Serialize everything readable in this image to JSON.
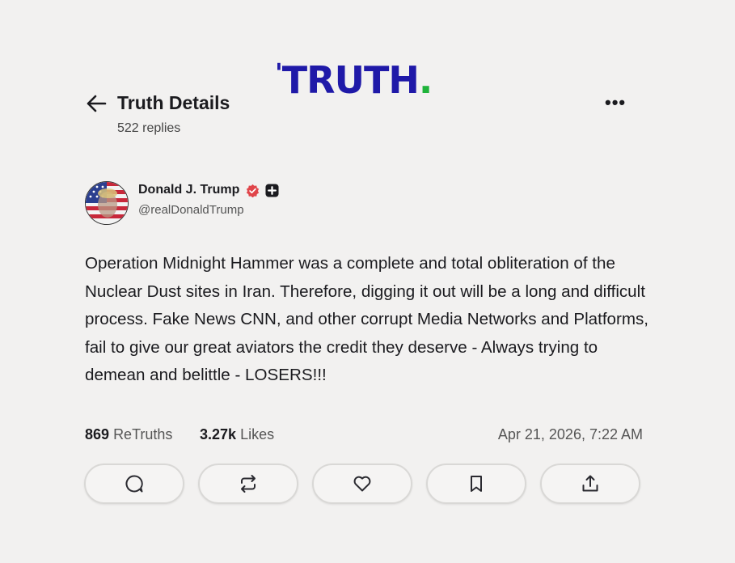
{
  "brand": {
    "logo_text": "TRUTH",
    "logo_dot": ".",
    "colors": {
      "logo": "#1f19a8",
      "dot": "#1fb33a",
      "verified": "#e0454a"
    }
  },
  "header": {
    "title": "Truth Details",
    "replies": "522 replies",
    "back_icon": "arrow-left-icon",
    "more_icon": "more-horizontal-icon"
  },
  "author": {
    "name": "Donald J. Trump",
    "handle": "@realDonaldTrump",
    "verified_icon": "verified-badge-icon",
    "badge_icon": "plus-badge-icon"
  },
  "post": {
    "text": "Operation Midnight Hammer was a complete and total obliteration of the Nuclear Dust sites in Iran. Therefore, digging it out will be a long and difficult process. Fake News CNN, and other corrupt Media Networks and Platforms, fail to give our great aviators the credit they deserve - Always trying to demean and belittle - LOSERS!!!"
  },
  "stats": {
    "retruths_count": "869",
    "retruths_label": "ReTruths",
    "likes_count": "3.27k",
    "likes_label": "Likes",
    "timestamp": "Apr 21, 2026, 7:22 AM"
  },
  "actions": [
    {
      "icon": "reply-icon"
    },
    {
      "icon": "retruth-icon"
    },
    {
      "icon": "heart-icon"
    },
    {
      "icon": "bookmark-icon"
    },
    {
      "icon": "share-icon"
    }
  ]
}
